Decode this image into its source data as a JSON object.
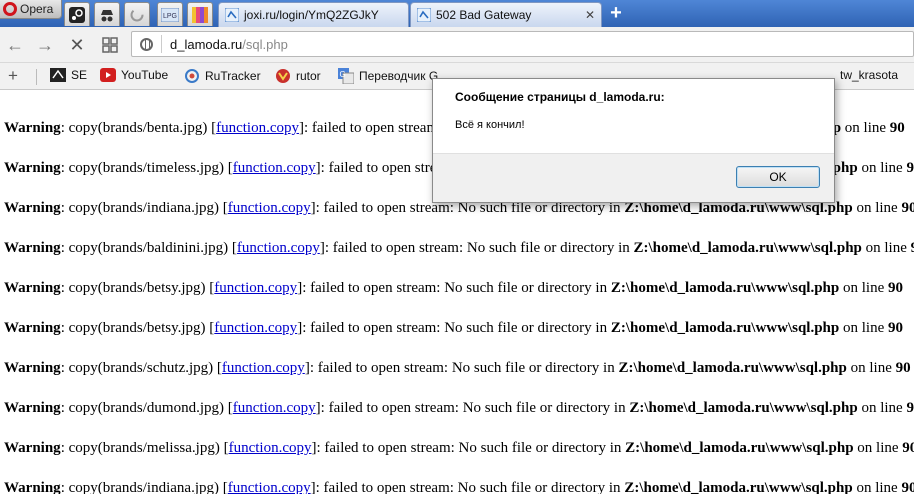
{
  "browser": {
    "menu_label": "Opera",
    "tabs": [
      {
        "title": "joxi.ru/login/YmQ2ZGJkY"
      },
      {
        "title": "502 Bad Gateway"
      }
    ],
    "new_tab": "+",
    "address": {
      "host": "d_lamoda.ru",
      "path": "/sql.php"
    },
    "bookmarks": [
      {
        "label": "SE"
      },
      {
        "label": "YouTube"
      },
      {
        "label": "RuTracker"
      },
      {
        "label": "rutor"
      },
      {
        "label": "Переводчик G"
      },
      {
        "label": "tw_krasota"
      }
    ]
  },
  "dialog": {
    "title": "Сообщение страницы d_lamoda.ru:",
    "message": "Всё я кончил!",
    "ok_label": "OK"
  },
  "warnings": {
    "label": "Warning",
    "link_text": "function.copy",
    "message": ": failed to open stream: No such file or directory in ",
    "file": "Z:\\home\\d_lamoda.ru\\www\\sql.php",
    "on_line": " on line ",
    "line_no": "90",
    "items": [
      {
        "call": "copy(brands/benta.jpg)"
      },
      {
        "call": "copy(brands/timeless.jpg)"
      },
      {
        "call": "copy(brands/indiana.jpg)"
      },
      {
        "call": "copy(brands/baldinini.jpg)"
      },
      {
        "call": "copy(brands/betsy.jpg)"
      },
      {
        "call": "copy(brands/betsy.jpg)"
      },
      {
        "call": "copy(brands/schutz.jpg)"
      },
      {
        "call": "copy(brands/dumond.jpg)"
      },
      {
        "call": "copy(brands/melissa.jpg)"
      },
      {
        "call": "copy(brands/indiana.jpg)"
      }
    ]
  }
}
